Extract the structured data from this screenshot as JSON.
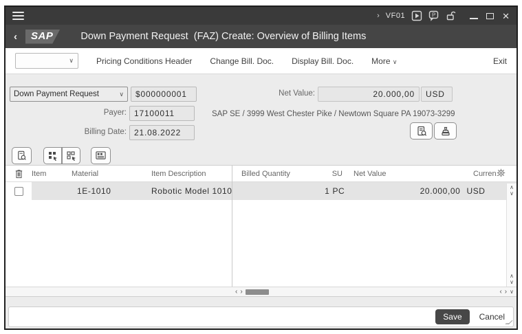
{
  "titlebar": {
    "nav_chevron": "›",
    "transaction_code": "VF01"
  },
  "appbar": {
    "back_chevron": "‹",
    "logo_text": "SAP",
    "title": "Down Payment Request  (FAZ) Create: Overview of Billing Items"
  },
  "menubar": {
    "combobox_value": "",
    "buttons": [
      {
        "label": "Pricing Conditions Header"
      },
      {
        "label": "Change Bill. Doc."
      },
      {
        "label": "Display Bill. Doc."
      }
    ],
    "more_label": "More",
    "exit_label": "Exit"
  },
  "form": {
    "document_type": "Down Payment Request",
    "document_number": "$000000001",
    "net_value_label": "Net Value:",
    "net_value": "20.000,00",
    "net_value_currency": "USD",
    "payer_label": "Payer:",
    "payer_value": "17100011",
    "payer_address": "SAP SE / 3999 West Chester Pike / Newtown Square PA 19073-3299",
    "billing_date_label": "Billing Date:",
    "billing_date_value": "21.08.2022"
  },
  "table": {
    "columns": {
      "item": "Item",
      "material": "Material",
      "description": "Item Description",
      "billed_quantity": "Billed Quantity",
      "su": "SU",
      "net_value": "Net Value",
      "currency": "Curren..."
    },
    "rows": [
      {
        "item": "",
        "material": "1E-1010",
        "description": "Robotic Model 1010",
        "billed_quantity": "1",
        "su": "PC",
        "net_value": "20.000,00",
        "currency": "USD"
      }
    ]
  },
  "footer": {
    "save_label": "Save",
    "cancel_label": "Cancel"
  },
  "colors": {
    "titlebar": "#3a3a3a",
    "appbar": "#454545",
    "content_bg": "#ececec",
    "row_bg": "#e4e4e4",
    "save_button": "#474747"
  }
}
